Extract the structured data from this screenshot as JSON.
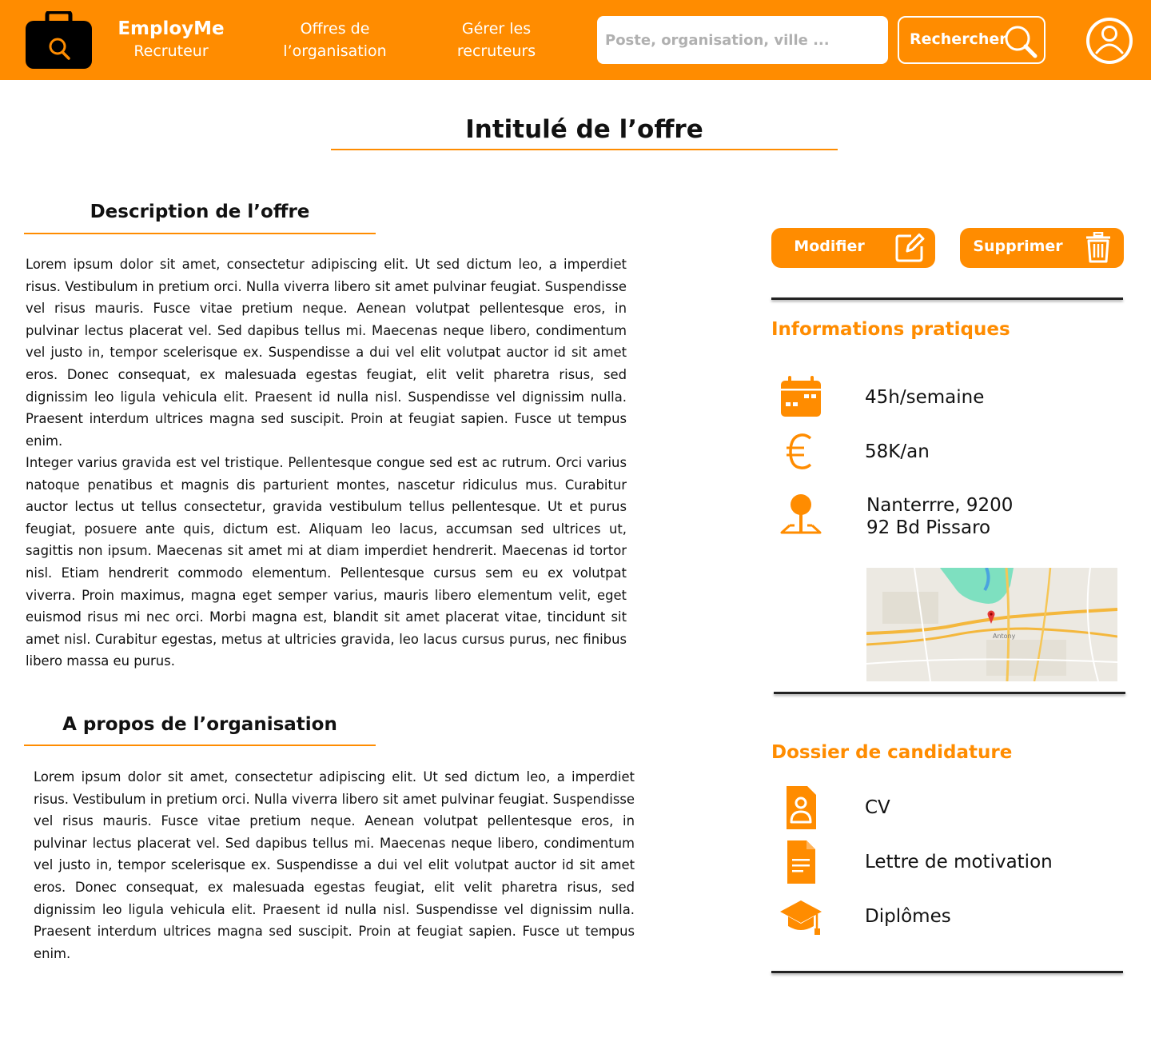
{
  "header": {
    "brand_name": "EmployMe",
    "brand_role": "Recruteur",
    "nav": {
      "offers_line1": "Offres de",
      "offers_line2": "l’organisation",
      "recruiters_line1": "Gérer les",
      "recruiters_line2": "recruteurs"
    },
    "search": {
      "placeholder": "Poste, organisation, ville ...",
      "button_label": "Rechercher"
    }
  },
  "offer": {
    "title": "Intitulé de l’offre",
    "description_title": "Description de l’offre",
    "description_p1": "Lorem ipsum dolor sit amet, consectetur adipiscing elit. Ut sed dictum leo, a imperdiet risus. Vestibulum in pretium orci. Nulla viverra libero sit amet pulvinar feugiat. Suspendisse vel risus mauris. Fusce vitae pretium neque. Aenean volutpat pellentesque eros, in pulvinar lectus placerat vel. Sed dapibus tellus mi. Maecenas neque libero, condimentum vel justo in, tempor scelerisque ex. Suspendisse a dui vel elit volutpat auctor id sit amet eros. Donec consequat, ex malesuada egestas feugiat, elit velit pharetra risus, sed dignissim leo ligula vehicula elit. Praesent id nulla nisl. Suspendisse vel dignissim nulla. Praesent interdum ultrices magna sed suscipit. Proin at feugiat sapien. Fusce ut tempus enim.",
    "description_p2": "Integer varius gravida est vel tristique. Pellentesque congue sed est ac rutrum. Orci varius natoque penatibus et magnis dis parturient montes, nascetur ridiculus mus. Curabitur auctor lectus ut tellus consectetur, gravida vestibulum tellus pellentesque. Ut et purus feugiat, posuere ante quis, dictum est. Aliquam leo lacus, accumsan sed ultrices ut, sagittis non ipsum. Maecenas sit amet mi at diam imperdiet hendrerit. Maecenas id tortor nisl. Etiam hendrerit commodo elementum. Pellentesque cursus sem eu ex volutpat viverra. Proin maximus, magna eget semper varius, mauris libero elementum velit, eget euismod risus mi nec orci. Morbi magna est, blandit sit amet placerat vitae, tincidunt sit amet nisl. Curabitur egestas, metus at ultricies gravida, leo lacus cursus purus, nec finibus libero massa eu purus.",
    "about_title": "A propos de l’organisation",
    "about_text": "Lorem ipsum dolor sit amet, consectetur adipiscing elit. Ut sed dictum leo, a imperdiet risus. Vestibulum in pretium orci. Nulla viverra libero sit amet pulvinar feugiat. Suspendisse vel risus mauris. Fusce vitae pretium neque. Aenean volutpat pellentesque eros, in pulvinar lectus placerat vel. Sed dapibus tellus mi. Maecenas neque libero, condimentum vel justo in, tempor scelerisque ex. Suspendisse a dui vel elit volutpat auctor id sit amet eros. Donec consequat, ex malesuada egestas feugiat, elit velit pharetra risus, sed dignissim leo ligula vehicula elit. Praesent id nulla nisl. Suspendisse vel dignissim nulla. Praesent interdum ultrices magna sed suscipit. Proin at feugiat sapien. Fusce ut tempus enim."
  },
  "actions": {
    "edit_label": "Modifier",
    "delete_label": "Supprimer"
  },
  "practical": {
    "title": "Informations pratiques",
    "hours": "45h/semaine",
    "salary": "58K/an",
    "address_line1": "Nanterrre, 9200",
    "address_line2": "92 Bd Pissaro",
    "map_place": "Antony"
  },
  "application": {
    "title": "Dossier de candidature",
    "items": [
      "CV",
      "Lettre de motivation",
      "Diplômes"
    ]
  },
  "icons": {
    "logo": "briefcase-search-icon",
    "search": "magnifier-icon",
    "profile": "user-circle-icon",
    "edit": "edit-icon",
    "delete": "trash-icon",
    "hours": "calendar-icon",
    "salary": "euro-icon",
    "address": "location-pin-icon",
    "cv": "cv-document-icon",
    "letter": "letter-document-icon",
    "diplomas": "graduation-cap-icon"
  },
  "colors": {
    "accent": "#ff8c00",
    "text": "#111111",
    "background": "#ffffff"
  }
}
